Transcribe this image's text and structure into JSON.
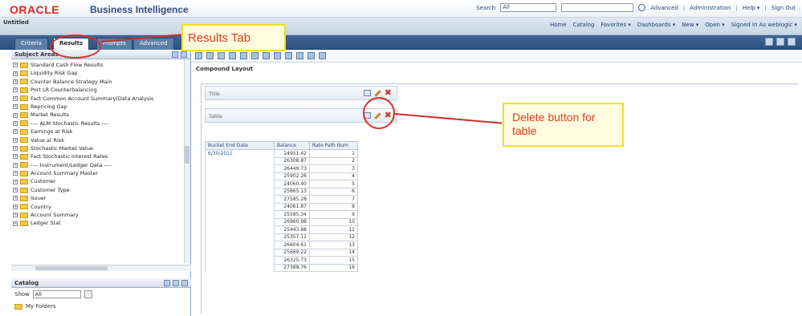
{
  "header": {
    "brand": "ORACLE",
    "product": "Business Intelligence",
    "search_label": "Search",
    "search_scope": "All",
    "links": [
      "Advanced",
      "Administration",
      "Help ▾",
      "Sign Out"
    ]
  },
  "band": {
    "title": "Untitled",
    "nav": [
      "Home",
      "Catalog",
      "Favorites ▾",
      "Dashboards ▾",
      "New ▾",
      "Open ▾",
      "Signed In As weblogic ▾"
    ]
  },
  "tabs": [
    "Criteria",
    "Results",
    "Prompts",
    "Advanced"
  ],
  "subject_areas": {
    "title": "Subject Areas",
    "items": [
      "Standard Cash Flow Results",
      "Liquidity Risk Gap",
      "Counter Balance Strategy Main",
      "Port LR Counterbalancing",
      "Fact Common Account Summary(Data Analysis",
      "Repricing Gap",
      "Market Results",
      "---- ALM Stochastic Results ----",
      "Earnings at Risk",
      "Value at Risk",
      "Stochastic Market Value",
      "Fact Stochastic Interest Rates",
      "---- Instrument/Ledger Data ----",
      "Account Summary Master",
      "Customer",
      "Customer Type",
      "Issuer",
      "Country",
      "Account Summary",
      "Ledger Stat"
    ]
  },
  "catalog": {
    "title": "Catalog",
    "show_label": "Show",
    "show_value": "All",
    "root": "My Folders"
  },
  "results": {
    "layout_title": "Compound Layout",
    "view_title": "Title",
    "view_table": "Table",
    "table": {
      "headers": [
        "Bucket End Date",
        "Balance",
        "Rate Path Num"
      ],
      "first_value": "6/30/2011",
      "rows": [
        [
          "24951.42",
          "1"
        ],
        [
          "26308.87",
          "2"
        ],
        [
          "26449.73",
          "3"
        ],
        [
          "25902.26",
          "4"
        ],
        [
          "24060.40",
          "5"
        ],
        [
          "25865.13",
          "6"
        ],
        [
          "27585.28",
          "7"
        ],
        [
          "24061.87",
          "8"
        ],
        [
          "25585.34",
          "9"
        ],
        [
          "26960.98",
          "10"
        ],
        [
          "25443.88",
          "11"
        ],
        [
          "25357.11",
          "12"
        ],
        [
          "26604.61",
          "13"
        ],
        [
          "25689.22",
          "14"
        ],
        [
          "26325.73",
          "15"
        ],
        [
          "27388.76",
          "16"
        ]
      ]
    }
  },
  "annotations": {
    "results_tab": "Results Tab",
    "delete_button": "Delete button for table"
  },
  "colors": {
    "oracle_red": "#e2231a",
    "tab_bar": "#2f5281",
    "annotation_border": "#f2e11c",
    "annotation_text": "#e23b1f",
    "circle": "#d3312b"
  }
}
